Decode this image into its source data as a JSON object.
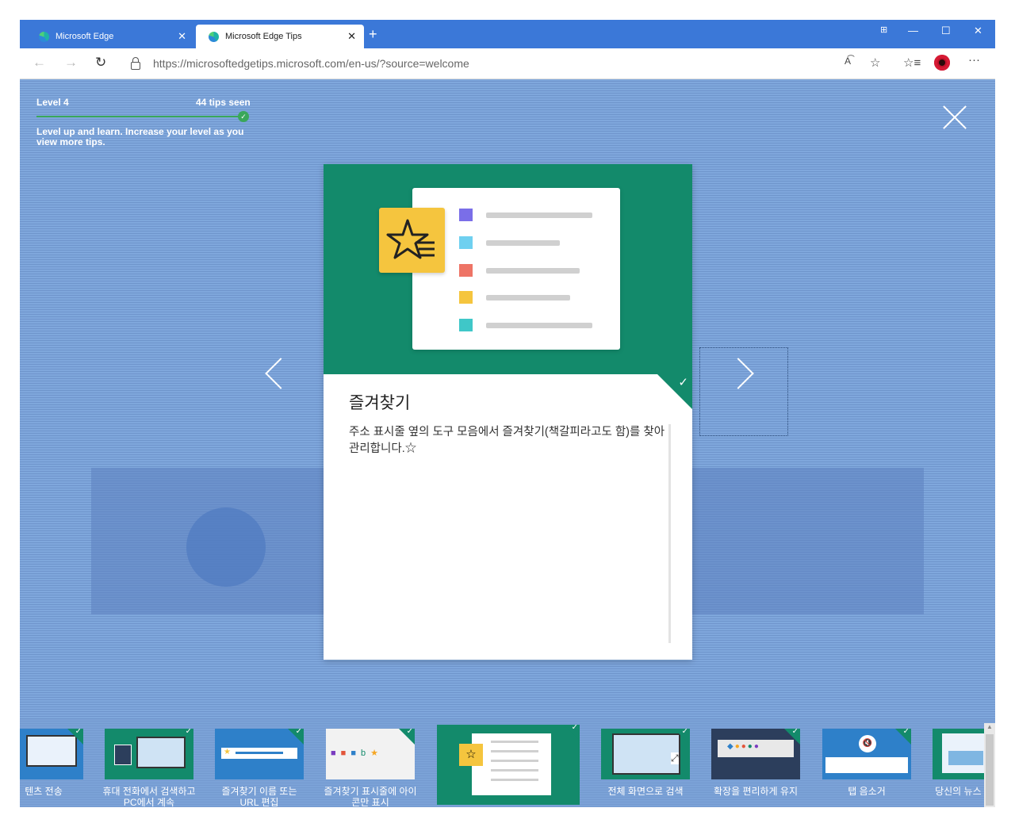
{
  "browser": {
    "tabs": [
      {
        "title": "Microsoft Edge",
        "active": false
      },
      {
        "title": "Microsoft Edge Tips",
        "active": true
      }
    ],
    "new_tab": "+",
    "window_controls": {
      "tile": "⊞",
      "minimize": "—",
      "maximize": "☐",
      "close": "✕"
    },
    "url_host": "https://microsoftedgetips.microsoft.com",
    "url_path": "/en-us/?source=welcome",
    "toolbar_icons": [
      "read-aloud-icon",
      "favorite-star-icon",
      "favorites-list-icon",
      "profile-avatar",
      "more-icon"
    ]
  },
  "progress": {
    "level": "Level 4",
    "tips_seen": "44 tips seen",
    "fraction": 1.0,
    "description": "Level up and learn. Increase your level as you view more tips."
  },
  "card": {
    "title": "즐겨찾기",
    "text": "주소 표시줄 옆의 도구 모음에서 즐겨찾기(책갈피라고도 함)를 찾아 관리합니다.☆",
    "hero_colors": {
      "bg": "#138a6b",
      "star": "#f5c53e",
      "rows": [
        "#7a6ee8",
        "#6fd0f0",
        "#ee7466",
        "#f5c53e",
        "#3fc7c8"
      ]
    }
  },
  "thumbnails": [
    {
      "label": "텐츠 전송",
      "bg": "#2e80c9"
    },
    {
      "label": "휴대 전화에서 검색하고 PC에서 계속",
      "bg": "#138a6b"
    },
    {
      "label": "즐겨찾기 이름 또는 URL 편집",
      "bg": "#2e80c9"
    },
    {
      "label": "즐겨찾기 표시줄에 아이콘만 표시",
      "bg": "#f2f2f2"
    },
    {
      "label": "",
      "bg": "#138a6b"
    },
    {
      "label": "전체 화면으로 검색",
      "bg": "#138a6b"
    },
    {
      "label": "확장을 편리하게 유지",
      "bg": "#2c3e5c"
    },
    {
      "label": "탭 음소거",
      "bg": "#2e80c9"
    },
    {
      "label": "당신의 뉴스 방법",
      "bg": "#138a6b"
    }
  ]
}
